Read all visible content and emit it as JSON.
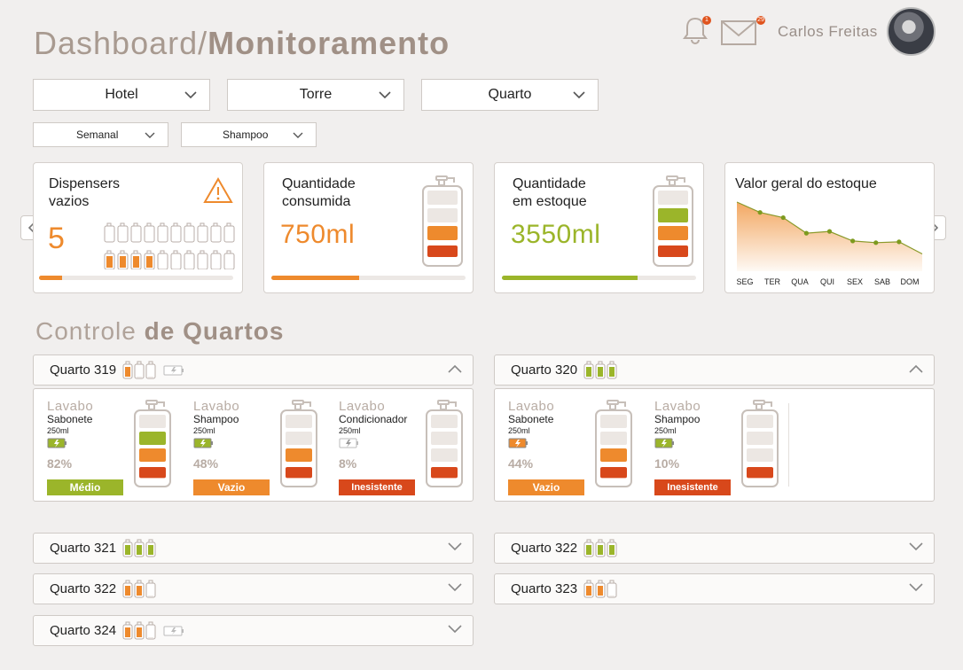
{
  "header": {
    "title_prefix": "Dashboard/",
    "title_main": "Monitoramento",
    "user_name": "Carlos Freitas",
    "notifications_count": "1",
    "messages_count": "29"
  },
  "filters": {
    "hotel": "Hotel",
    "torre": "Torre",
    "quarto": "Quarto",
    "periodo": "Semanal",
    "produto": "Shampoo"
  },
  "cards": {
    "empty": {
      "label_line1": "Dispensers",
      "label_line2": "vazios",
      "value": "5",
      "progress": 0.12
    },
    "consumed": {
      "label_line1": "Quantidade",
      "label_line2": "consumida",
      "value": "750ml",
      "progress": 0.45
    },
    "stock": {
      "label_line1": "Quantidade",
      "label_line2": "em estoque",
      "value": "3550ml",
      "progress": 0.7
    },
    "value": {
      "label": "Valor geral do estoque",
      "days": [
        "SEG",
        "TER",
        "QUA",
        "QUI",
        "SEX",
        "SAB",
        "DOM"
      ]
    }
  },
  "chart_data": {
    "type": "area",
    "title": "Valor geral do estoque",
    "categories": [
      "SEG",
      "TER",
      "QUA",
      "QUI",
      "SEX",
      "SAB",
      "DOM"
    ],
    "values": [
      100,
      88,
      82,
      64,
      66,
      55,
      53,
      54,
      40
    ]
  },
  "section": {
    "prefix": "Controle ",
    "main": "de Quartos"
  },
  "rooms": {
    "r319": {
      "name": "Quarto 319",
      "dispensers": [
        {
          "loc": "Lavabo",
          "prod": "Sabonete",
          "vol": "250ml",
          "pct": "82%",
          "status": "Médio"
        },
        {
          "loc": "Lavabo",
          "prod": "Shampoo",
          "vol": "250ml",
          "pct": "48%",
          "status": "Vazio"
        },
        {
          "loc": "Lavabo",
          "prod": "Condicionador",
          "vol": "250ml",
          "pct": "8%",
          "status": "Inesistente"
        }
      ]
    },
    "r320": {
      "name": "Quarto 320",
      "dispensers": [
        {
          "loc": "Lavabo",
          "prod": "Sabonete",
          "vol": "250ml",
          "pct": "44%",
          "status": "Vazio"
        },
        {
          "loc": "Lavabo",
          "prod": "Shampoo",
          "vol": "250ml",
          "pct": "10%",
          "status": "Inesistente"
        }
      ]
    },
    "r321": {
      "name": "Quarto 321"
    },
    "r322a": {
      "name": "Quarto 322"
    },
    "r322b": {
      "name": "Quarto 322"
    },
    "r323": {
      "name": "Quarto 323"
    },
    "r324": {
      "name": "Quarto 324"
    }
  },
  "colors": {
    "green": "#9bb52a",
    "orange": "#ee8a2d",
    "red": "#d8481b",
    "empty": "#ece7e3",
    "accent": "#a89a90"
  }
}
